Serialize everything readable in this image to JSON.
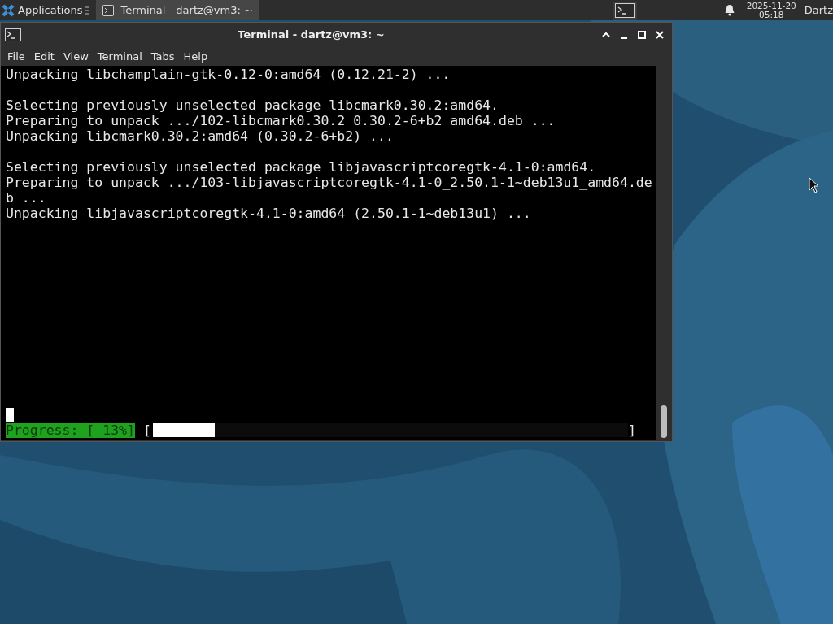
{
  "panel": {
    "apps_label": "Applications",
    "tasks": [
      {
        "title": "Terminal - dartz@vm3: ~",
        "selected": true
      }
    ],
    "clock": {
      "date": "2025-11-20",
      "time": "05:18"
    },
    "user": "Dartz"
  },
  "window": {
    "title": "Terminal - dartz@vm3: ~",
    "menu": [
      "File",
      "Edit",
      "View",
      "Terminal",
      "Tabs",
      "Help"
    ]
  },
  "terminal": {
    "blocks": [
      [
        "Unpacking libchamplain-gtk-0.12-0:amd64 (0.12.21-2) ..."
      ],
      [
        "Selecting previously unselected package libcmark0.30.2:amd64.",
        "Preparing to unpack .../102-libcmark0.30.2_0.30.2-6+b2_amd64.deb ...",
        "Unpacking libcmark0.30.2:amd64 (0.30.2-6+b2) ..."
      ],
      [
        "Selecting previously unselected package libjavascriptcoregtk-4.1-0:amd64.",
        "Preparing to unpack .../103-libjavascriptcoregtk-4.1-0_2.50.1-1~deb13u1_amd64.de",
        "b ...",
        "Unpacking libjavascriptcoregtk-4.1-0:amd64 (2.50.1-1~deb13u1) ..."
      ]
    ],
    "progress": {
      "label": "Progress: [ 13%]",
      "open": "[",
      "close": "]",
      "level": 0.13
    }
  }
}
